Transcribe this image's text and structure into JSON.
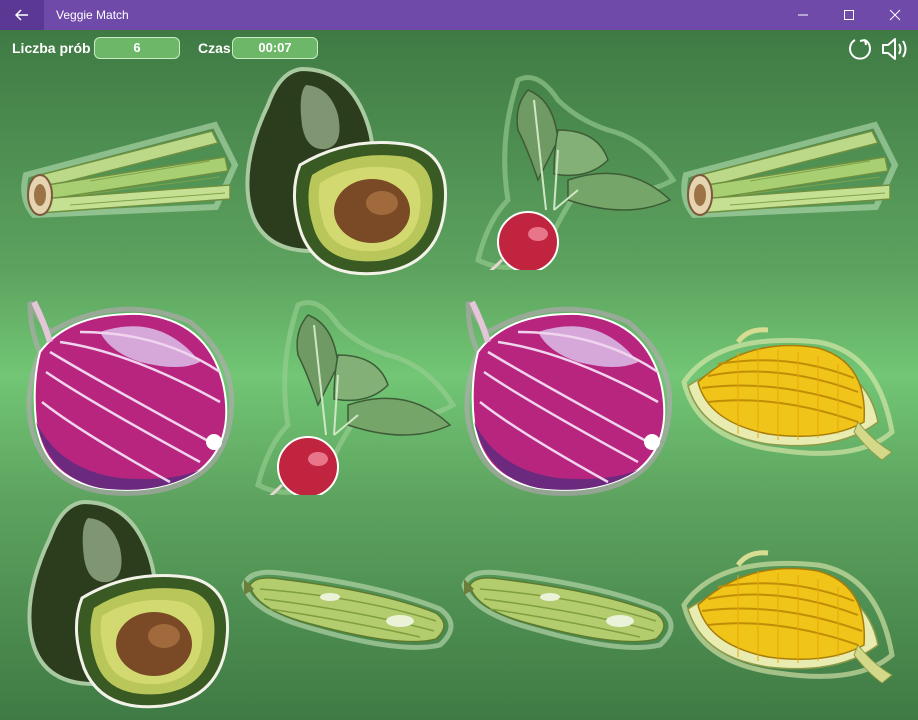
{
  "window": {
    "title": "Veggie Match",
    "accent": "#6f4aa9"
  },
  "hud": {
    "tries_label": "Liczba prób",
    "tries_value": "6",
    "time_label": "Czas",
    "time_value": "00:07",
    "restart_icon": "restart-icon",
    "sound_icon": "speaker-icon"
  },
  "board": {
    "rows": 3,
    "cols": 4,
    "cards": [
      [
        "celery",
        "avocado",
        "radish",
        "celery"
      ],
      [
        "red-onion",
        "radish",
        "red-onion",
        "corn"
      ],
      [
        "avocado",
        "zucchini",
        "zucchini",
        "corn"
      ]
    ]
  }
}
